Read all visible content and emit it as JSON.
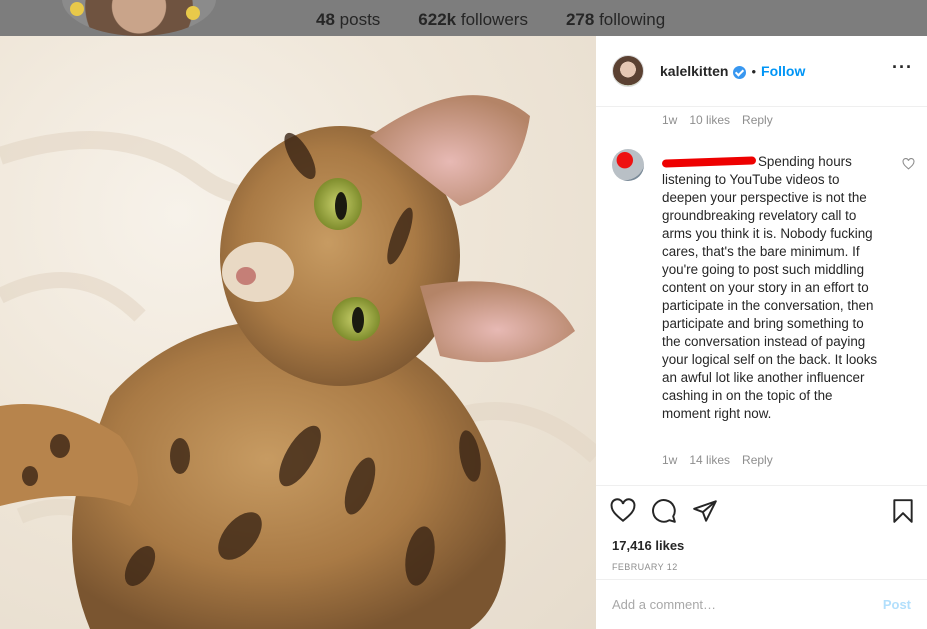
{
  "profile_bg": {
    "stats": [
      {
        "value": "48",
        "label": "posts"
      },
      {
        "value": "622k",
        "label": "followers"
      },
      {
        "value": "278",
        "label": "following"
      }
    ]
  },
  "post": {
    "username": "kalelkitten",
    "separator": "•",
    "follow_label": "Follow",
    "more_icon": "more-icon",
    "likes": "17,416 likes",
    "date": "FEBRUARY 12"
  },
  "comments": [
    {
      "time": "1w",
      "likes": "10 likes",
      "reply": "Reply"
    },
    {
      "text": "Spending hours listening to YouTube videos to deepen your perspective is not the groundbreaking revelatory call to arms you think it is. Nobody fucking cares, that's the bare minimum. If you're going to post such middling content on your story in an effort to participate in the conversation, then participate and bring something to the conversation instead of paying your logical self on the back. It looks an awful lot like another influencer cashing in on the topic of the moment right now.",
      "time": "1w",
      "likes": "14 likes",
      "reply": "Reply"
    }
  ],
  "add_comment": {
    "placeholder": "Add a comment…",
    "post_label": "Post"
  },
  "colors": {
    "accent": "#0095f6",
    "verified": "#3897f0",
    "post_disabled": "#b2dffc",
    "redaction": "#e00000"
  }
}
